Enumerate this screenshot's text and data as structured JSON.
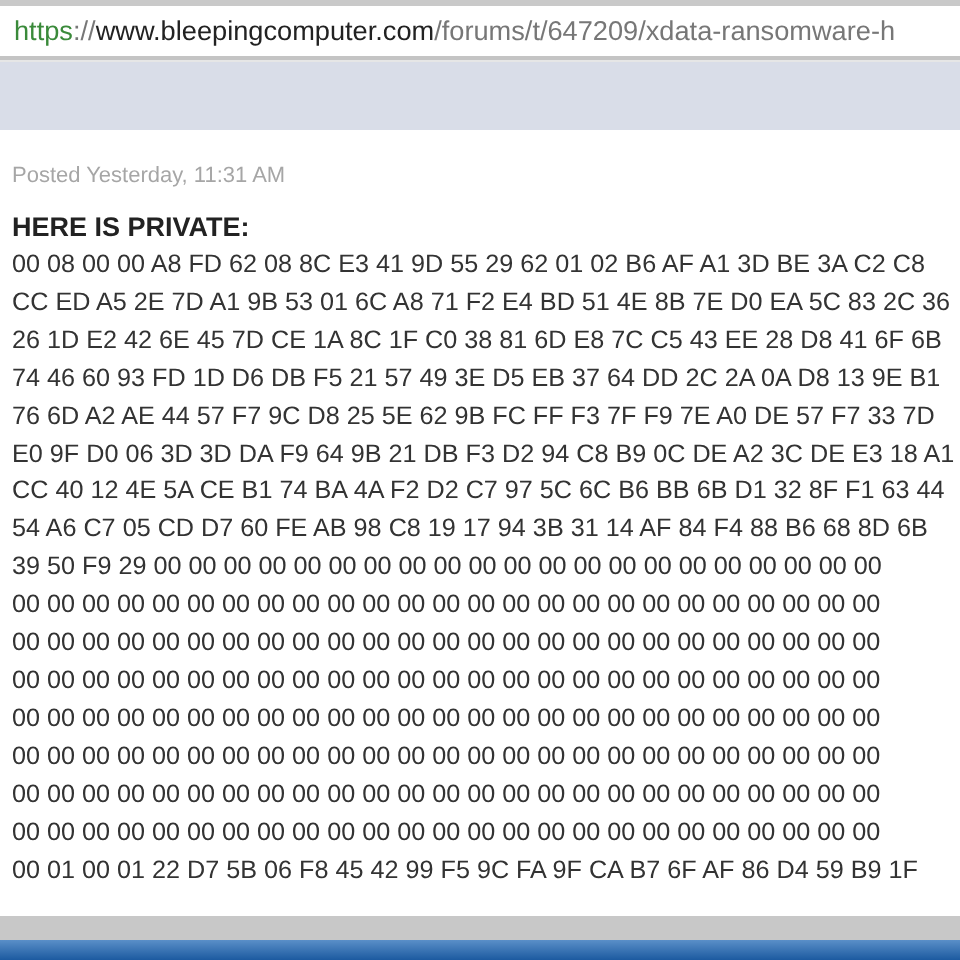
{
  "address_bar": {
    "scheme": "https",
    "separator": "://",
    "host": "www.bleepingcomputer.com",
    "path": "/forums/t/647209/xdata-ransomware-h"
  },
  "post": {
    "meta": "Posted Yesterday, 11:31 AM",
    "heading": "HERE IS PRIVATE:",
    "lines": [
      "00 08 00 00 A8 FD 62 08 8C E3 41 9D 55 29 62 01 02 B6 AF A1 3D BE 3A C2 C8",
      "CC ED A5 2E 7D A1 9B 53 01 6C A8 71 F2 E4 BD 51 4E 8B 7E D0 EA 5C 83 2C 36",
      "26 1D E2 42 6E 45 7D CE 1A 8C 1F C0 38 81 6D E8 7C C5 43 EE 28 D8 41 6F 6B",
      "74 46 60 93 FD 1D D6 DB F5 21 57 49 3E D5 EB 37 64 DD 2C 2A 0A D8 13 9E B1",
      "76 6D A2 AE 44 57 F7 9C D8 25 5E 62 9B FC FF F3 7F F9 7E A0 DE 57 F7 33 7D",
      "E0 9F D0 06 3D 3D DA F9 64 9B 21 DB F3 D2 94 C8 B9 0C DE A2 3C DE E3 18 A1",
      "CC 40 12 4E 5A CE B1 74 BA 4A F2 D2 C7 97 5C 6C B6 BB 6B D1 32 8F F1 63 44",
      "54 A6 C7 05 CD D7 60 FE AB 98 C8 19 17 94 3B 31 14 AF 84 F4 88 B6 68 8D 6B",
      "39 50 F9 29 00 00 00 00 00 00 00 00 00 00 00 00 00 00 00 00 00 00 00 00 00",
      "00 00 00 00 00 00 00 00 00 00 00 00 00 00 00 00 00 00 00 00 00 00 00 00 00",
      "00 00 00 00 00 00 00 00 00 00 00 00 00 00 00 00 00 00 00 00 00 00 00 00 00",
      "00 00 00 00 00 00 00 00 00 00 00 00 00 00 00 00 00 00 00 00 00 00 00 00 00",
      "00 00 00 00 00 00 00 00 00 00 00 00 00 00 00 00 00 00 00 00 00 00 00 00 00",
      "00 00 00 00 00 00 00 00 00 00 00 00 00 00 00 00 00 00 00 00 00 00 00 00 00",
      "00 00 00 00 00 00 00 00 00 00 00 00 00 00 00 00 00 00 00 00 00 00 00 00 00",
      "00 00 00 00 00 00 00 00 00 00 00 00 00 00 00 00 00 00 00 00 00 00 00 00 00",
      "00 01 00 01 22 D7 5B 06 F8 45 42 99 F5 9C FA 9F CA B7 6F AF 86 D4 59 B9 1F"
    ]
  }
}
